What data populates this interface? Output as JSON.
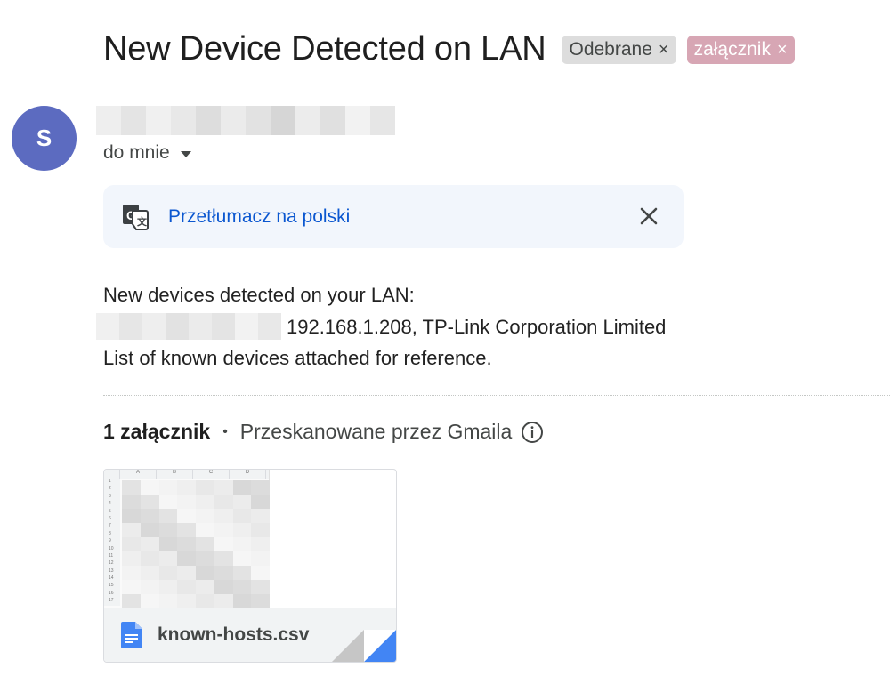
{
  "email": {
    "subject": "New Device Detected on LAN",
    "labels": [
      {
        "text": "Odebrane",
        "remove": "×"
      },
      {
        "text": "załącznik",
        "remove": "×"
      }
    ],
    "sender_initial": "S",
    "recipient": "do mnie",
    "translate_text": "Przetłumacz na polski",
    "body": {
      "line1": "New devices detected on your LAN:",
      "line2": "192.168.1.208, TP-Link Corporation Limited",
      "line3": "List of known devices attached for reference."
    },
    "attachments": {
      "count_label": "1 załącznik",
      "separator": "•",
      "scanned_label": "Przeskanowane przez Gmaila",
      "file_name": "known-hosts.csv",
      "sheet_columns": [
        "A",
        "B",
        "C",
        "D"
      ],
      "sheet_rows": [
        "1",
        "2",
        "3",
        "4",
        "5",
        "6",
        "7",
        "8",
        "9",
        "10",
        "11",
        "12",
        "13",
        "14",
        "15",
        "16",
        "17"
      ]
    }
  },
  "colors": {
    "avatar": "#5c6bc0",
    "link": "#0b57d0",
    "label_inbox": "#dddddd",
    "label_attachment": "#d7a6b4",
    "doc_icon": "#4285f4"
  }
}
